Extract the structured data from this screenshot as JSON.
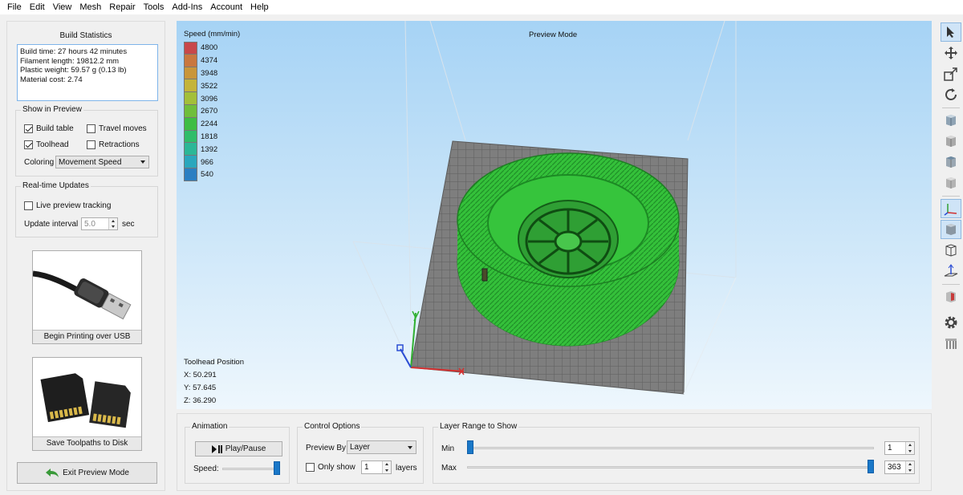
{
  "menu": [
    "File",
    "Edit",
    "View",
    "Mesh",
    "Repair",
    "Tools",
    "Add-Ins",
    "Account",
    "Help"
  ],
  "build_statistics": {
    "title": "Build Statistics",
    "lines": [
      "Build time: 27 hours 42 minutes",
      "Filament length: 19812.2 mm",
      "Plastic weight: 59.57 g (0.13 lb)",
      "Material cost: 2.74"
    ]
  },
  "show_in_preview": {
    "title": "Show in Preview",
    "build_table": {
      "label": "Build table",
      "checked": true
    },
    "travel_moves": {
      "label": "Travel moves",
      "checked": false
    },
    "toolhead": {
      "label": "Toolhead",
      "checked": true
    },
    "retractions": {
      "label": "Retractions",
      "checked": false
    },
    "coloring_label": "Coloring",
    "coloring_value": "Movement Speed"
  },
  "realtime": {
    "title": "Real-time Updates",
    "live_tracking": {
      "label": "Live preview tracking",
      "checked": false
    },
    "interval_label": "Update interval",
    "interval_value": "5.0",
    "interval_unit": "sec"
  },
  "buttons": {
    "usb": "Begin Printing over USB",
    "sd": "Save Toolpaths to Disk",
    "exit": "Exit Preview Mode"
  },
  "viewport": {
    "legend_title": "Speed (mm/min)",
    "mode_label": "Preview Mode",
    "legend": [
      {
        "value": "4800",
        "color": "#c8474a"
      },
      {
        "value": "4374",
        "color": "#c9773f"
      },
      {
        "value": "3948",
        "color": "#c9963a"
      },
      {
        "value": "3522",
        "color": "#c4b43a"
      },
      {
        "value": "3096",
        "color": "#a3bf3a"
      },
      {
        "value": "2670",
        "color": "#6fbe3c"
      },
      {
        "value": "2244",
        "color": "#3ebd44"
      },
      {
        "value": "1818",
        "color": "#2fbd6a"
      },
      {
        "value": "1392",
        "color": "#2bb797"
      },
      {
        "value": "966",
        "color": "#2aa7bd"
      },
      {
        "value": "540",
        "color": "#2b7fc2"
      }
    ],
    "toolhead_title": "Toolhead Position",
    "toolhead_x": "X: 50.291",
    "toolhead_y": "Y: 57.645",
    "toolhead_z": "Z: 36.290"
  },
  "animation": {
    "title": "Animation",
    "play_label": "Play/Pause",
    "speed_label": "Speed:",
    "speed_level": 0.95
  },
  "control_options": {
    "title": "Control Options",
    "preview_by_label": "Preview By",
    "preview_by_value": "Layer",
    "only_show_label": "Only show",
    "only_show_checked": false,
    "only_show_value": "1",
    "layers_label": "layers"
  },
  "layer_range": {
    "title": "Layer Range to Show",
    "min_label": "Min",
    "min_value": "1",
    "max_label": "Max",
    "max_value": "363"
  },
  "toolbar_icons": [
    "select-arrow-icon",
    "move-icon",
    "scale-icon",
    "rotate-icon",
    "view-front-icon",
    "view-side-icon",
    "view-top-icon",
    "view-iso-icon",
    "axes-icon",
    "solid-view-icon",
    "wireframe-icon",
    "normal-icon",
    "section-icon",
    "settings-gear-icon",
    "supports-icon"
  ]
}
